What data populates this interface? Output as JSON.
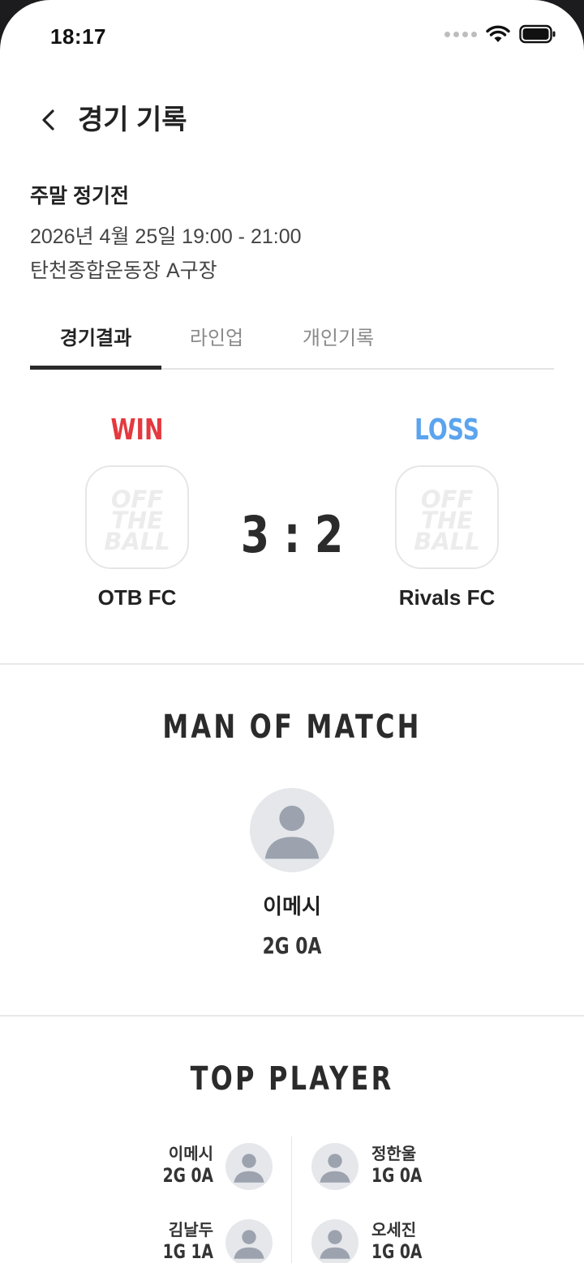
{
  "status_bar": {
    "time": "18:17"
  },
  "header": {
    "title": "경기 기록"
  },
  "match": {
    "name": "주말 정기전",
    "datetime": "2026년 4월 25일 19:00 - 21:00",
    "place": "탄천종합운동장 A구장"
  },
  "tabs": [
    {
      "label": "경기결과",
      "active": true
    },
    {
      "label": "라인업",
      "active": false
    },
    {
      "label": "개인기록",
      "active": false
    }
  ],
  "scoreboard": {
    "home": {
      "result": "WIN",
      "name": "OTB FC",
      "result_color": "#e3393f"
    },
    "away": {
      "result": "LOSS",
      "name": "Rivals FC",
      "result_color": "#5ba4ee"
    },
    "score": "3 : 2",
    "logo_text": [
      "OFF",
      "THE",
      "BALL"
    ]
  },
  "man_of_match": {
    "title": "MAN OF MATCH",
    "player": {
      "name": "이메시",
      "stat": "2G 0A"
    }
  },
  "top_player": {
    "title": "TOP PLAYER",
    "left": [
      {
        "name": "이메시",
        "stat": "2G 0A"
      },
      {
        "name": "김날두",
        "stat": "1G 1A"
      }
    ],
    "right": [
      {
        "name": "정한울",
        "stat": "1G 0A"
      },
      {
        "name": "오세진",
        "stat": "1G 0A"
      }
    ]
  },
  "colors": {
    "accent_win": "#e3393f",
    "accent_loss": "#5ba4ee",
    "avatar_bg": "#e5e7eb",
    "avatar_fg": "#9ca3af"
  },
  "icons": {
    "back": "chevron-left-icon",
    "wifi": "wifi-icon",
    "battery": "battery-icon",
    "avatar": "person-icon"
  }
}
